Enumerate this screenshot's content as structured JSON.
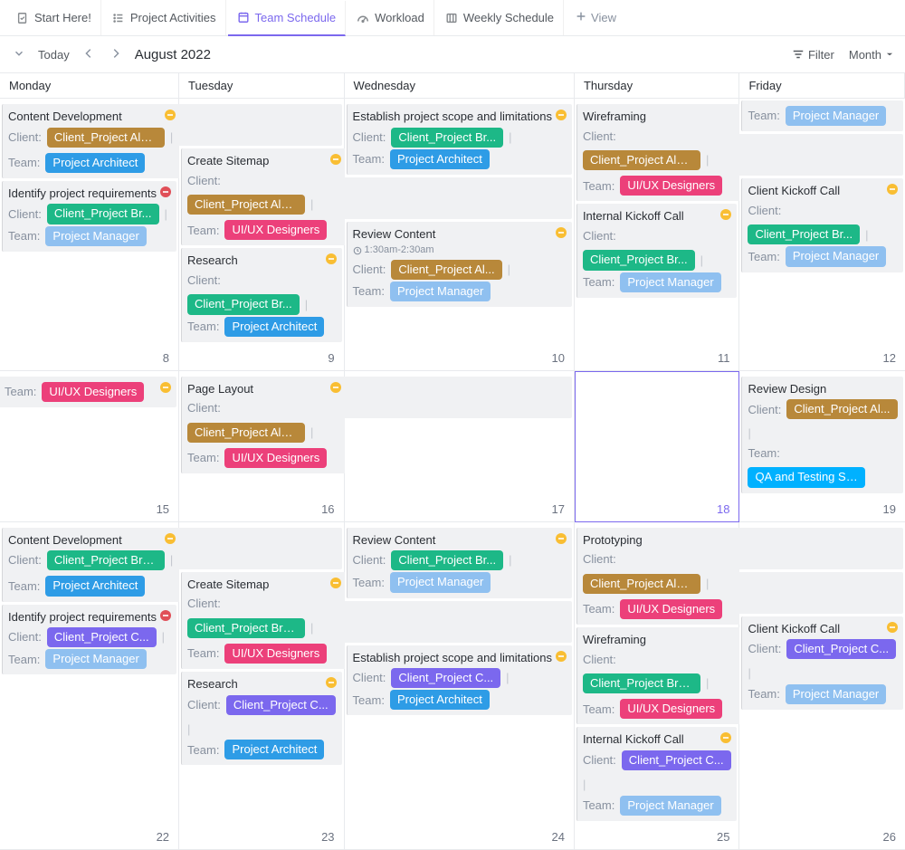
{
  "tabs": [
    {
      "label": "Start Here!",
      "icon": "doc-check"
    },
    {
      "label": "Project Activities",
      "icon": "list"
    },
    {
      "label": "Team Schedule",
      "icon": "calendar",
      "active": true
    },
    {
      "label": "Workload",
      "icon": "gauge"
    },
    {
      "label": "Weekly Schedule",
      "icon": "kanban"
    }
  ],
  "view_btn": "View",
  "toolbar": {
    "today": "Today",
    "title": "August 2022",
    "filter": "Filter",
    "month": "Month"
  },
  "day_headers": [
    "Monday",
    "Tuesday",
    "Wednesday",
    "Thursday",
    "Friday"
  ],
  "labels": {
    "client": "Client:",
    "team": "Team:"
  },
  "colors": {
    "alpha": "#b8883a",
    "bravo": "#1db887",
    "charlie": "#7b68ee",
    "architect": "#2e9ce6",
    "manager": "#8fc0f0",
    "uiux": "#ec407a",
    "qa": "#00b1ff",
    "status_progress": "#f9be33",
    "status_blocked": "#e04f58"
  },
  "weeks": [
    {
      "dates": [
        "8",
        "9",
        "10",
        "11",
        "12"
      ],
      "today_idx": -1,
      "rows": [
        [
          {
            "type": "event",
            "span": 2,
            "title": "Content Development",
            "status": "progress",
            "pills": [
              [
                "client",
                "Client_Project Alpha",
                "alpha"
              ],
              [
                "sep"
              ],
              [
                "team",
                "Project Architect",
                "architect"
              ]
            ]
          },
          null,
          {
            "type": "event",
            "span": 1,
            "title": "Establish project scope and limitations",
            "status": "progress",
            "pills": [
              [
                "client",
                "Client_Project Br...",
                "bravo"
              ],
              [
                "sep"
              ]
            ],
            "pills2": [
              [
                "team",
                "Project Architect",
                "architect"
              ]
            ]
          },
          {
            "type": "event",
            "span": 2,
            "title": "Wireframing",
            "pills": [
              [
                "client",
                "Client_Project Alpha",
                "alpha"
              ],
              [
                "sep"
              ],
              [
                "team",
                "UI/UX Designers",
                "uiux"
              ]
            ]
          },
          null
        ],
        [
          {
            "type": "event",
            "span": 1,
            "title": "Identify project requirements",
            "status": "blocked",
            "pills": [
              [
                "client",
                "Client_Project Br...",
                "bravo"
              ],
              [
                "sep"
              ]
            ],
            "pills2": [
              [
                "team",
                "Project Manager",
                "manager"
              ]
            ]
          },
          {
            "type": "empty"
          },
          {
            "type": "empty"
          },
          {
            "type": "event",
            "span": 1,
            "title": "Internal Kickoff Call",
            "status": "progress",
            "pills": [
              [
                "client",
                "Client_Project Br...",
                "bravo"
              ],
              [
                "sep"
              ]
            ],
            "pills2": [
              [
                "team",
                "Project Manager",
                "manager"
              ]
            ]
          },
          {
            "type": "empty"
          }
        ],
        [
          {
            "type": "empty"
          },
          {
            "type": "event",
            "span": 2,
            "title": "Create Sitemap",
            "status": "progress",
            "pills": [
              [
                "client",
                "Client_Project Alpha",
                "alpha"
              ],
              [
                "sep"
              ],
              [
                "team",
                "UI/UX Designers",
                "uiux"
              ]
            ]
          },
          null,
          {
            "type": "empty"
          },
          {
            "type": "event",
            "span": 1,
            "title": "Client Kickoff Call",
            "status": "progress",
            "pills": [
              [
                "client",
                "Client_Project Br...",
                "bravo"
              ],
              [
                "sep"
              ]
            ],
            "pills2": [
              [
                "team",
                "Project Manager",
                "manager"
              ]
            ]
          }
        ],
        [
          {
            "type": "empty"
          },
          {
            "type": "event",
            "span": 1,
            "title": "Research",
            "status": "progress",
            "pills": [
              [
                "client",
                "Client_Project Br...",
                "bravo"
              ],
              [
                "sep"
              ]
            ],
            "pills2": [
              [
                "team",
                "Project Architect",
                "architect"
              ]
            ]
          },
          {
            "type": "empty"
          },
          {
            "type": "empty"
          },
          {
            "type": "empty"
          }
        ],
        [
          {
            "type": "empty"
          },
          {
            "type": "empty"
          },
          {
            "type": "event",
            "span": 1,
            "title": "Review Content",
            "status": "progress",
            "time": "1:30am-2:30am",
            "pills": [
              [
                "client",
                "Client_Project Al...",
                "alpha"
              ],
              [
                "sep"
              ]
            ],
            "pills2": [
              [
                "team",
                "Project Manager",
                "manager"
              ]
            ]
          },
          {
            "type": "empty"
          },
          {
            "type": "empty"
          }
        ]
      ],
      "partial": [
        {
          "col": 4,
          "title_frag": "Team:",
          "chip": "Project Manager",
          "chip_color": "manager"
        }
      ]
    },
    {
      "dates": [
        "15",
        "16",
        "17",
        "18",
        "19"
      ],
      "today_idx": 3,
      "rows": [
        [
          {
            "type": "cont",
            "span": 1,
            "status": "progress",
            "pills": [
              [
                "team",
                "UI/UX Designers",
                "uiux"
              ]
            ]
          },
          {
            "type": "event",
            "span": 2,
            "title": "Page Layout",
            "status": "progress",
            "pills": [
              [
                "client",
                "Client_Project Alpha",
                "alpha"
              ],
              [
                "sep"
              ],
              [
                "team",
                "UI/UX Designers",
                "uiux"
              ]
            ]
          },
          null,
          {
            "type": "empty"
          },
          {
            "type": "event",
            "span": 1,
            "title": "Review Design",
            "pills": [
              [
                "client",
                "Client_Project Al...",
                "alpha"
              ],
              [
                "sep"
              ]
            ],
            "pills2": [
              [
                "team",
                "QA and Testing Specialist",
                "qa"
              ]
            ]
          }
        ]
      ]
    },
    {
      "dates": [
        "22",
        "23",
        "24",
        "25",
        "26"
      ],
      "today_idx": -1,
      "rows": [
        [
          {
            "type": "event",
            "span": 2,
            "title": "Content Development",
            "status": "progress",
            "pills": [
              [
                "client",
                "Client_Project Bravo",
                "bravo"
              ],
              [
                "sep"
              ],
              [
                "team",
                "Project Architect",
                "architect"
              ]
            ]
          },
          null,
          {
            "type": "event",
            "span": 1,
            "title": "Review Content",
            "status": "progress",
            "pills": [
              [
                "client",
                "Client_Project Br...",
                "bravo"
              ],
              [
                "sep"
              ]
            ],
            "pills2": [
              [
                "team",
                "Project Manager",
                "manager"
              ]
            ]
          },
          {
            "type": "event",
            "span": 2,
            "title": "Prototyping",
            "pills": [
              [
                "client",
                "Client_Project Alpha",
                "alpha"
              ],
              [
                "sep"
              ],
              [
                "team",
                "UI/UX Designers",
                "uiux"
              ]
            ]
          },
          null
        ],
        [
          {
            "type": "event",
            "span": 1,
            "title": "Identify project requirements",
            "status": "blocked",
            "pills": [
              [
                "client",
                "Client_Project C...",
                "charlie"
              ],
              [
                "sep"
              ]
            ],
            "pills2": [
              [
                "team",
                "Project Manager",
                "manager"
              ]
            ]
          },
          {
            "type": "event",
            "span": 2,
            "title": "Create Sitemap",
            "status": "progress",
            "pills": [
              [
                "client",
                "Client_Project Bravo",
                "bravo"
              ],
              [
                "sep"
              ],
              [
                "team",
                "UI/UX Designers",
                "uiux"
              ]
            ]
          },
          null,
          {
            "type": "event",
            "span": 2,
            "title": "Wireframing",
            "pills": [
              [
                "client",
                "Client_Project Bravo",
                "bravo"
              ],
              [
                "sep"
              ],
              [
                "team",
                "UI/UX Designers",
                "uiux"
              ]
            ]
          },
          null
        ],
        [
          {
            "type": "empty"
          },
          {
            "type": "event",
            "span": 1,
            "title": "Research",
            "status": "progress",
            "pills": [
              [
                "client",
                "Client_Project C...",
                "charlie"
              ],
              [
                "sep"
              ]
            ],
            "pills2": [
              [
                "team",
                "Project Architect",
                "architect"
              ]
            ]
          },
          {
            "type": "empty"
          },
          {
            "type": "event",
            "span": 1,
            "title": "Internal Kickoff Call",
            "status": "progress",
            "pills": [
              [
                "client",
                "Client_Project C...",
                "charlie"
              ],
              [
                "sep"
              ]
            ],
            "pills2": [
              [
                "team",
                "Project Manager",
                "manager"
              ]
            ]
          },
          {
            "type": "empty"
          }
        ],
        [
          {
            "type": "empty"
          },
          {
            "type": "empty"
          },
          {
            "type": "event",
            "span": 1,
            "title": "Establish project scope and limitations",
            "status": "progress",
            "pills": [
              [
                "client",
                "Client_Project C...",
                "charlie"
              ],
              [
                "sep"
              ]
            ],
            "pills2": [
              [
                "team",
                "Project Architect",
                "architect"
              ]
            ]
          },
          {
            "type": "empty"
          },
          {
            "type": "event",
            "span": 1,
            "title": "Client Kickoff Call",
            "status": "progress",
            "pills": [
              [
                "client",
                "Client_Project C...",
                "charlie"
              ],
              [
                "sep"
              ]
            ],
            "pills2": [
              [
                "team",
                "Project Manager",
                "manager"
              ]
            ]
          }
        ]
      ]
    }
  ]
}
